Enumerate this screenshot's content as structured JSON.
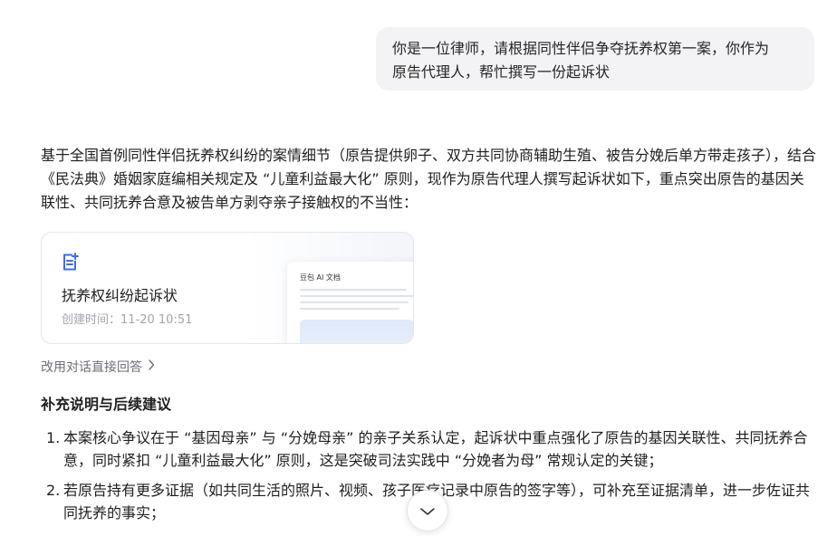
{
  "user_message": {
    "line1": "你是一位律师，请根据同性伴侣争夺抚养权第一案，你作为",
    "line2": "原告代理人，帮忙撰写一份起诉状"
  },
  "answer": {
    "intro": "基于全国首例同性伴侣抚养权纠纷的案情细节（原告提供卵子、双方共同协商辅助生殖、被告分娩后单方带走孩子），结合《民法典》婚姻家庭编相关规定及 “儿童利益最大化” 原则，现作为原告代理人撰写起诉状如下，重点突出原告的基因关联性、共同抚养合意及被告单方剥夺亲子接触权的不当性："
  },
  "document_card": {
    "icon": "document-edit-icon",
    "title": "抚养权纠纷起诉状",
    "created_time": "创建时间：11-20 10:51",
    "preview_title": "豆包 AI 文档"
  },
  "switch_link": {
    "label": "改用对话直接回答",
    "icon": "chevron-right-icon"
  },
  "section_heading": "补充说明与后续建议",
  "suggestions": [
    {
      "num": "1.",
      "text": "本案核心争议在于 “基因母亲” 与 “分娩母亲” 的亲子关系认定，起诉状中重点强化了原告的基因关联性、共同抚养合意，同时紧扣 “儿童利益最大化” 原则，这是突破司法实践中 “分娩者为母” 常规认定的关键；"
    },
    {
      "num": "2.",
      "text": "若原告持有更多证据（如共同生活的照片、视频、孩子医疗记录中原告的签字等），可补充至证据清单，进一步佐证共同抚养的事实；"
    }
  ],
  "scroll_button": {
    "icon": "chevron-down-icon"
  },
  "colors": {
    "accent": "#3a6cf5",
    "bubble_bg": "#f3f3f5",
    "muted_text": "#a3a6ad"
  }
}
